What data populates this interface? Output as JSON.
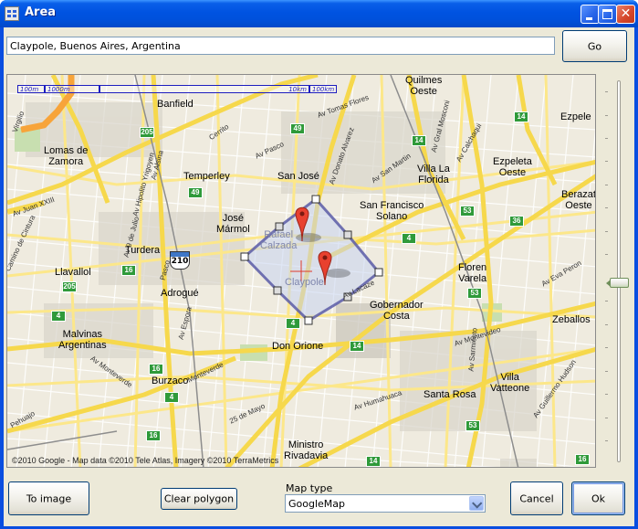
{
  "window": {
    "title": "Area"
  },
  "search": {
    "value": "Claypole, Buenos Aires, Argentina",
    "go_label": "Go"
  },
  "map": {
    "scale": [
      "100m",
      "1000m",
      "10km",
      "100km"
    ],
    "copyright": "©2010 Google - Map data ©2010 Tele Atlas, Imagery ©2010 TerraMetrics",
    "places": [
      {
        "id": "quilmes",
        "text": "Quilmes\nOeste"
      },
      {
        "id": "banfield",
        "text": "Banfield"
      },
      {
        "id": "lomas",
        "text": "Lomas de\nZamora"
      },
      {
        "id": "temperley",
        "text": "Temperley"
      },
      {
        "id": "sanjose",
        "text": "San José"
      },
      {
        "id": "villala",
        "text": "Villa La\nFlorida"
      },
      {
        "id": "ezpeleta",
        "text": "Ezpeleta\nOeste"
      },
      {
        "id": "ezpele",
        "text": "Ezpele"
      },
      {
        "id": "berazat",
        "text": "Berazat\nOeste"
      },
      {
        "id": "josemarmol",
        "text": "José\nMármol"
      },
      {
        "id": "sanfrancisco",
        "text": "San Francisco\nSolano"
      },
      {
        "id": "turdera",
        "text": "Turdera"
      },
      {
        "id": "rafael",
        "text": "Rafael\nCalzada"
      },
      {
        "id": "llavallol",
        "text": "Llavallol"
      },
      {
        "id": "florencio",
        "text": "Floren\nVarela"
      },
      {
        "id": "claypole",
        "text": "Claypole"
      },
      {
        "id": "adrogue",
        "text": "Adrogué"
      },
      {
        "id": "gobernador",
        "text": "Gobernador\nCosta"
      },
      {
        "id": "zeballos",
        "text": "Zeballos"
      },
      {
        "id": "malvinas",
        "text": "Malvinas\nArgentinas"
      },
      {
        "id": "donorione",
        "text": "Don Orione"
      },
      {
        "id": "burzaco",
        "text": "Burzaco"
      },
      {
        "id": "villavatteone",
        "text": "Villa\nVatteone"
      },
      {
        "id": "santarosa",
        "text": "Santa Rosa"
      },
      {
        "id": "ministro",
        "text": "Ministro\nRivadavia"
      }
    ],
    "roads": [
      "Av Juan XXIII",
      "Virgilio",
      "Av Tomas Flores",
      "Av Donato Alvarez",
      "Av Pasco",
      "Cerrito",
      "Av Alsina",
      "Av Hipolito Yrigoyen",
      "Av 9 de Julio",
      "Av San Martin",
      "Av Calchaqui",
      "Av Gral Mosconi",
      "Camino de Cintura",
      "Av Espora",
      "Av Monteverde",
      "Av Lacaze",
      "Av Humahuaca",
      "Monteverde",
      "Av Sarmiento",
      "Av Guillermo Hudson",
      "25 de Mayo",
      "Pehuajo",
      "Av Montevideo",
      "Av Eva Peron",
      "Pasco"
    ],
    "shields": [
      "205",
      "49",
      "14",
      "14",
      "49",
      "53",
      "36",
      "4",
      "16",
      "205",
      "4",
      "16",
      "4",
      "14",
      "53",
      "4",
      "16",
      "53",
      "14",
      "16"
    ],
    "route_badge": "210"
  },
  "footer": {
    "to_image": "To image",
    "clear_polygon": "Clear polygon",
    "map_type_label": "Map type",
    "map_type_value": "GoogleMap",
    "cancel": "Cancel",
    "ok": "Ok"
  }
}
